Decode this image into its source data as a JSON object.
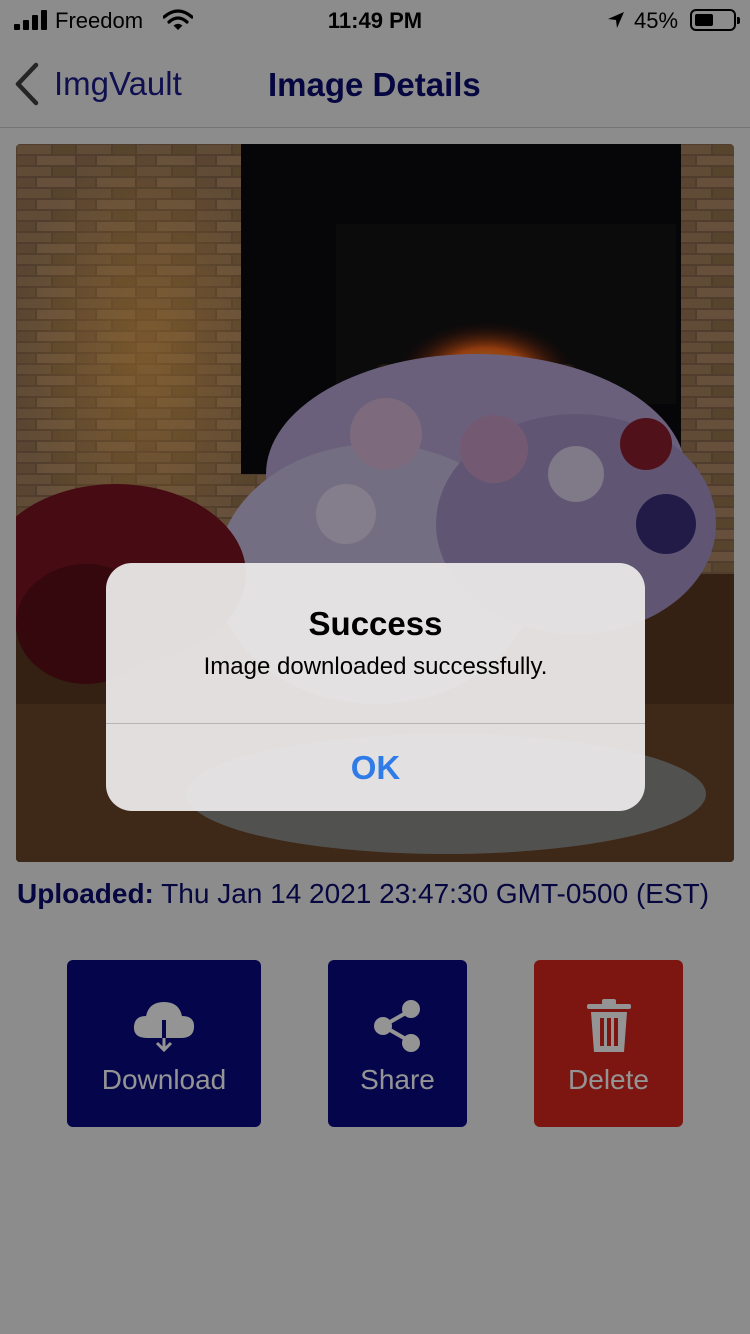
{
  "status_bar": {
    "carrier": "Freedom",
    "time": "11:49 PM",
    "battery_percent": "45%",
    "battery_level": 0.45,
    "signal_bars": 4
  },
  "nav": {
    "back_label": "ImgVault",
    "title": "Image Details"
  },
  "photo": {
    "subject": "fireplace with flower bouquet"
  },
  "uploaded": {
    "label": "Uploaded:",
    "value": "Thu Jan 14 2021 23:47:30 GMT-0500 (EST)"
  },
  "actions": {
    "download": {
      "label": "Download",
      "icon": "cloud-download-icon",
      "color": "#0a0a82"
    },
    "share": {
      "label": "Share",
      "icon": "share-icon",
      "color": "#0a0a82"
    },
    "delete": {
      "label": "Delete",
      "icon": "trash-icon",
      "color": "#d8261c"
    }
  },
  "alert": {
    "title": "Success",
    "message": "Image downloaded successfully.",
    "ok_label": "OK",
    "accent_color": "#2f7be8"
  }
}
